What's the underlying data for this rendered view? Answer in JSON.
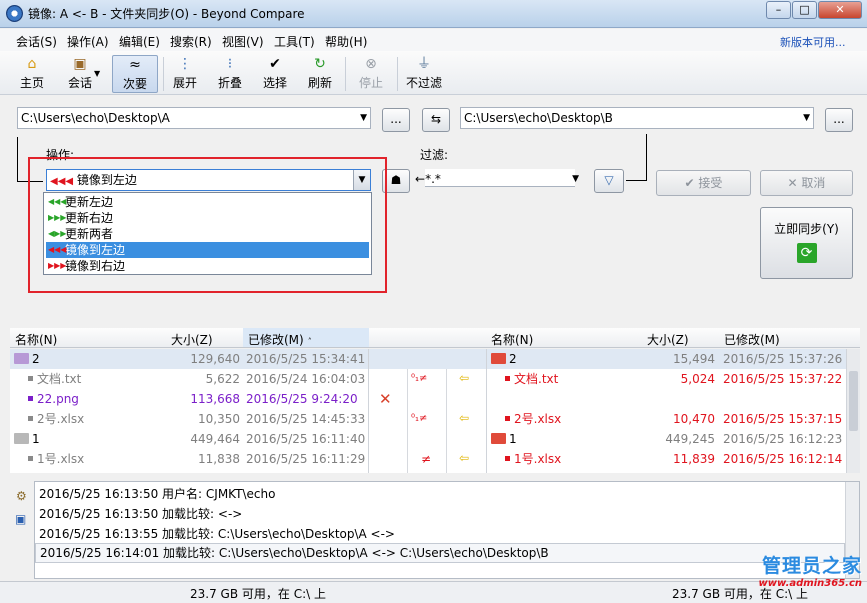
{
  "window": {
    "title": "镜像: A <- B - 文件夹同步(O) - Beyond Compare",
    "minimize": "–",
    "maximize": "□",
    "close": "✕"
  },
  "menu": [
    "会话(S)",
    "操作(A)",
    "编辑(E)",
    "搜索(R)",
    "视图(V)",
    "工具(T)",
    "帮助(H)"
  ],
  "new_version": "新版本可用...",
  "toolbar": {
    "home": "主页",
    "session": "会话",
    "next": "次要",
    "expand": "展开",
    "collapse": "折叠",
    "select": "选择",
    "refresh": "刷新",
    "stop": "停止",
    "nofilter": "不过滤"
  },
  "paths": {
    "left": "C:\\Users\\echo\\Desktop\\A",
    "right": "C:\\Users\\echo\\Desktop\\B",
    "browse": "..."
  },
  "action": {
    "label": "操作:",
    "selected": "镜像到左边"
  },
  "filter": {
    "label": "过滤:",
    "value": "*.*"
  },
  "buttons": {
    "accept": "接受",
    "cancel": "取消",
    "sync_now": "立即同步(Y)"
  },
  "dropdown": {
    "items": [
      {
        "label": "更新左边",
        "color": "#2aa52a"
      },
      {
        "label": "更新右边",
        "color": "#2aa52a"
      },
      {
        "label": "更新两者",
        "color": "#2aa52a"
      },
      {
        "label": "镜像到左边",
        "color": "#e0141e"
      },
      {
        "label": "镜像到右边",
        "color": "#e0141e"
      }
    ]
  },
  "columns": {
    "name": "名称(N)",
    "size": "大小(Z)",
    "modified": "已修改(M)"
  },
  "left_rows": [
    {
      "name": "2",
      "size": "129,640",
      "date": "2016/5/25 15:34:41"
    },
    {
      "name": "文档.txt",
      "size": "5,622",
      "date": "2016/5/24 16:04:03"
    },
    {
      "name": "22.png",
      "size": "113,668",
      "date": "2016/5/25 9:24:20"
    },
    {
      "name": "2号.xlsx",
      "size": "10,350",
      "date": "2016/5/25 14:45:33"
    },
    {
      "name": "1",
      "size": "449,464",
      "date": "2016/5/25 16:11:40"
    },
    {
      "name": "1号.xlsx",
      "size": "11,838",
      "date": "2016/5/25 16:11:29"
    }
  ],
  "right_rows": [
    {
      "name": "2",
      "size": "15,494",
      "date": "2016/5/25 15:37:26"
    },
    {
      "name": "文档.txt",
      "size": "5,024",
      "date": "2016/5/25 15:37:22"
    },
    {
      "name": "",
      "size": "",
      "date": ""
    },
    {
      "name": "2号.xlsx",
      "size": "10,470",
      "date": "2016/5/25 15:37:15"
    },
    {
      "name": "1",
      "size": "449,245",
      "date": "2016/5/25 16:12:23"
    },
    {
      "name": "1号.xlsx",
      "size": "11,839",
      "date": "2016/5/25 16:12:14"
    }
  ],
  "log": [
    "2016/5/25 16:13:50  用户名: CJMKT\\echo",
    "2016/5/25 16:13:50  加载比较: <->",
    "2016/5/25 16:13:55  加载比较: C:\\Users\\echo\\Desktop\\A <->",
    "2016/5/25 16:14:01  加载比较: C:\\Users\\echo\\Desktop\\A <-> C:\\Users\\echo\\Desktop\\B"
  ],
  "status": {
    "left": "23.7 GB 可用，在 C:\\ 上",
    "right": "23.7 GB 可用，在 C:\\ 上"
  },
  "watermark": {
    "line1": "管理员之家",
    "line2": "www.admin365.cn"
  }
}
